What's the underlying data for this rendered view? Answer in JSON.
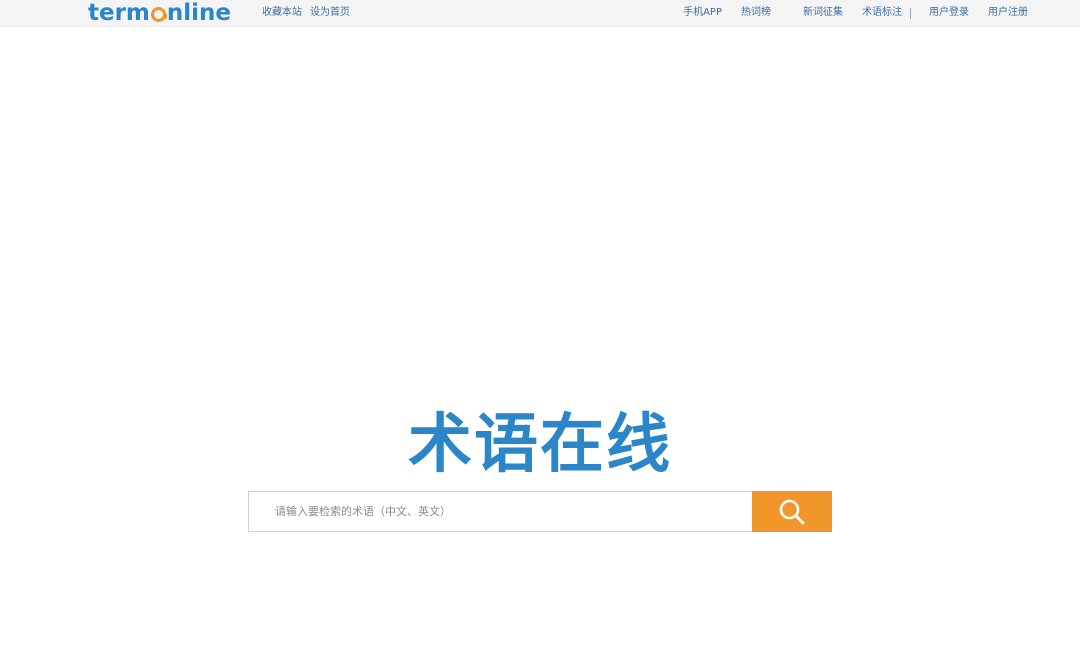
{
  "header": {
    "logo": {
      "prefix": "term",
      "suffix": "nline"
    },
    "left_links": [
      "收藏本站",
      "设为首页"
    ],
    "right_links": [
      "手机APP",
      "热词榜",
      "新词征集",
      "术语标注"
    ],
    "account_links": [
      "用户登录",
      "用户注册"
    ]
  },
  "brand": {
    "title": "术语在线"
  },
  "search": {
    "placeholder": "请输入要检索的术语（中文、英文）",
    "value": "",
    "button_icon": "search-icon"
  },
  "colors": {
    "brand_blue": "#2a86c8",
    "accent_orange": "#f0962b",
    "link_blue": "#3b6fa5",
    "topbar_bg": "#f4f4f4"
  }
}
